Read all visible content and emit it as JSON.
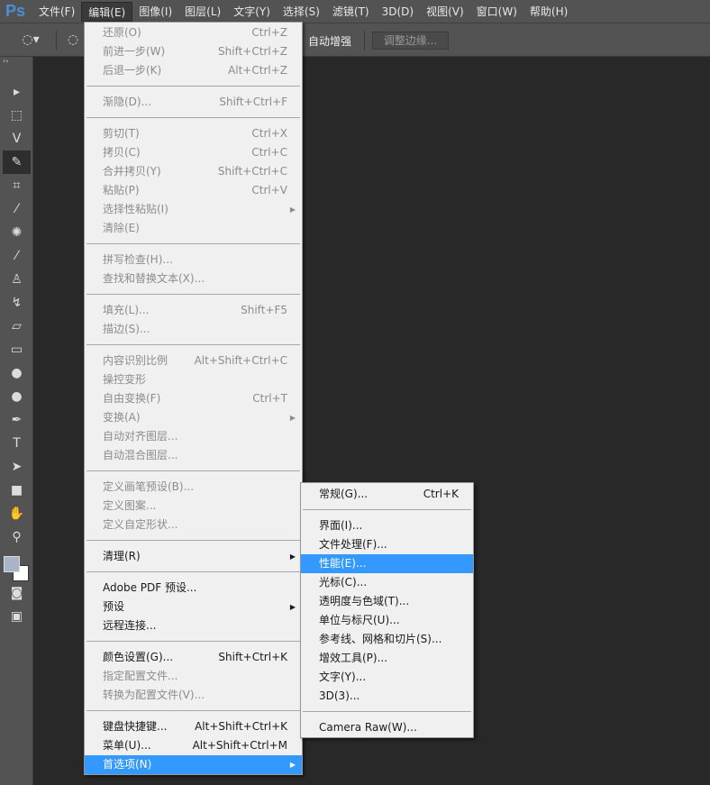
{
  "menubar": {
    "logo": "Ps",
    "items": [
      "文件(F)",
      "编辑(E)",
      "图像(I)",
      "图层(L)",
      "文字(Y)",
      "选择(S)",
      "滤镜(T)",
      "3D(D)",
      "视图(V)",
      "窗口(W)",
      "帮助(H)"
    ],
    "active": 1
  },
  "options": {
    "auto_enhance": "自动增强",
    "refine_edge": "调整边缘..."
  },
  "tools": [
    "move",
    "marquee",
    "lasso",
    "quick-selection",
    "crop",
    "eyedropper",
    "spot-healing",
    "brush",
    "clone-stamp",
    "history-brush",
    "eraser",
    "gradient",
    "blur",
    "dodge",
    "pen",
    "type",
    "path-selection",
    "rectangle",
    "hand",
    "zoom"
  ],
  "edit_menu": [
    {
      "label": "还原(O)",
      "shortcut": "Ctrl+Z",
      "disabled": true
    },
    {
      "label": "前进一步(W)",
      "shortcut": "Shift+Ctrl+Z",
      "disabled": true
    },
    {
      "label": "后退一步(K)",
      "shortcut": "Alt+Ctrl+Z",
      "disabled": true
    },
    {
      "sep": true
    },
    {
      "label": "渐隐(D)...",
      "shortcut": "Shift+Ctrl+F",
      "disabled": true
    },
    {
      "sep": true
    },
    {
      "label": "剪切(T)",
      "shortcut": "Ctrl+X",
      "disabled": true
    },
    {
      "label": "拷贝(C)",
      "shortcut": "Ctrl+C",
      "disabled": true
    },
    {
      "label": "合并拷贝(Y)",
      "shortcut": "Shift+Ctrl+C",
      "disabled": true
    },
    {
      "label": "粘贴(P)",
      "shortcut": "Ctrl+V",
      "disabled": true
    },
    {
      "label": "选择性粘贴(I)",
      "shortcut": "",
      "disabled": true,
      "submenu": true
    },
    {
      "label": "清除(E)",
      "shortcut": "",
      "disabled": true
    },
    {
      "sep": true
    },
    {
      "label": "拼写检查(H)...",
      "shortcut": "",
      "disabled": true
    },
    {
      "label": "查找和替换文本(X)...",
      "shortcut": "",
      "disabled": true
    },
    {
      "sep": true
    },
    {
      "label": "填充(L)...",
      "shortcut": "Shift+F5",
      "disabled": true
    },
    {
      "label": "描边(S)...",
      "shortcut": "",
      "disabled": true
    },
    {
      "sep": true
    },
    {
      "label": "内容识别比例",
      "shortcut": "Alt+Shift+Ctrl+C",
      "disabled": true
    },
    {
      "label": "操控变形",
      "shortcut": "",
      "disabled": true
    },
    {
      "label": "自由变换(F)",
      "shortcut": "Ctrl+T",
      "disabled": true
    },
    {
      "label": "变换(A)",
      "shortcut": "",
      "disabled": true,
      "submenu": true
    },
    {
      "label": "自动对齐图层...",
      "shortcut": "",
      "disabled": true
    },
    {
      "label": "自动混合图层...",
      "shortcut": "",
      "disabled": true
    },
    {
      "sep": true
    },
    {
      "label": "定义画笔预设(B)...",
      "shortcut": "",
      "disabled": true
    },
    {
      "label": "定义图案...",
      "shortcut": "",
      "disabled": true
    },
    {
      "label": "定义自定形状...",
      "shortcut": "",
      "disabled": true
    },
    {
      "sep": true
    },
    {
      "label": "清理(R)",
      "shortcut": "",
      "submenu": true
    },
    {
      "sep": true
    },
    {
      "label": "Adobe PDF 预设...",
      "shortcut": ""
    },
    {
      "label": "预设",
      "shortcut": "",
      "submenu": true
    },
    {
      "label": "远程连接...",
      "shortcut": ""
    },
    {
      "sep": true
    },
    {
      "label": "颜色设置(G)...",
      "shortcut": "Shift+Ctrl+K"
    },
    {
      "label": "指定配置文件...",
      "shortcut": "",
      "disabled": true
    },
    {
      "label": "转换为配置文件(V)...",
      "shortcut": "",
      "disabled": true
    },
    {
      "sep": true
    },
    {
      "label": "键盘快捷键...",
      "shortcut": "Alt+Shift+Ctrl+K"
    },
    {
      "label": "菜单(U)...",
      "shortcut": "Alt+Shift+Ctrl+M"
    },
    {
      "label": "首选项(N)",
      "shortcut": "",
      "submenu": true,
      "highlighted": true
    }
  ],
  "prefs_menu": [
    {
      "label": "常规(G)...",
      "shortcut": "Ctrl+K"
    },
    {
      "sep": true
    },
    {
      "label": "界面(I)...",
      "shortcut": ""
    },
    {
      "label": "文件处理(F)...",
      "shortcut": ""
    },
    {
      "label": "性能(E)...",
      "shortcut": "",
      "highlighted": true
    },
    {
      "label": "光标(C)...",
      "shortcut": ""
    },
    {
      "label": "透明度与色域(T)...",
      "shortcut": ""
    },
    {
      "label": "单位与标尺(U)...",
      "shortcut": ""
    },
    {
      "label": "参考线、网格和切片(S)...",
      "shortcut": ""
    },
    {
      "label": "增效工具(P)...",
      "shortcut": ""
    },
    {
      "label": "文字(Y)...",
      "shortcut": ""
    },
    {
      "label": "3D(3)...",
      "shortcut": ""
    },
    {
      "sep": true
    },
    {
      "label": "Camera Raw(W)...",
      "shortcut": ""
    }
  ]
}
